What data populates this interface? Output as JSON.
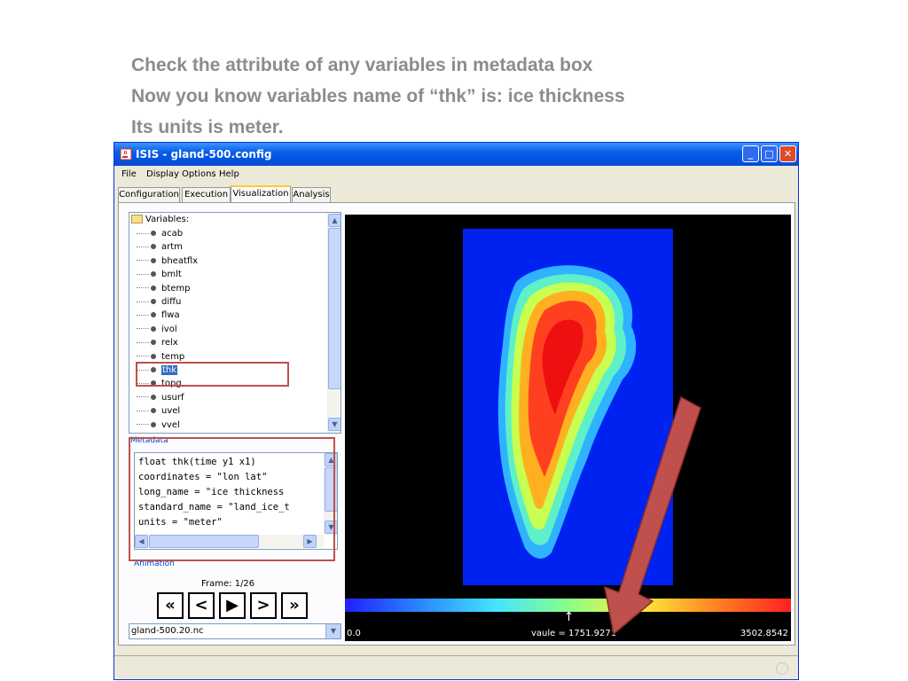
{
  "slide": {
    "lines": [
      "Check the attribute of any variables in metadata box",
      "Now you know variables name of “thk” is: ice thickness",
      "Its units is meter."
    ]
  },
  "window": {
    "title": "ISIS - gland-500.config",
    "min_label": "_",
    "max_label": "□",
    "close_label": "✕"
  },
  "menu": {
    "file": "File",
    "display_options": "Display Options",
    "help": "Help"
  },
  "tabs": [
    "Configuration",
    "Execution",
    "Visualization",
    "Analysis"
  ],
  "active_tab": "Visualization",
  "tree": {
    "root_label": "Variables:",
    "items": [
      "acab",
      "artm",
      "bheatflx",
      "bmlt",
      "btemp",
      "diffu",
      "flwa",
      "ivol",
      "relx",
      "temp",
      "thk",
      "topg",
      "usurf",
      "uvel",
      "vvel"
    ],
    "selected": "thk"
  },
  "metadata": {
    "group_label": "Metadata",
    "lines": [
      "float thk(time y1 x1)",
      "coordinates = \"lon lat\"",
      "long_name = \"ice thickness",
      "standard_name = \"land_ice_t",
      "units = \"meter\""
    ]
  },
  "animation": {
    "group_label": "Animation",
    "frame_label": "Frame:  1/26",
    "buttons": [
      "«",
      "<",
      "▶",
      ">",
      "»"
    ]
  },
  "file_select": {
    "value": "gland-500.20.nc"
  },
  "colorbar": {
    "min": "0.0",
    "max": "3502.8542",
    "value_label": "vaule = 1751.9271",
    "value": 1751.9271,
    "marker": "↑"
  },
  "colors": {
    "callout": "#c0504d",
    "arrow_fill": "#c0504d",
    "titlebar": "#0054e3"
  },
  "icons": {
    "java": "java-cup-icon",
    "folder": "folder-icon",
    "scroll_up": "chevron-up-icon",
    "scroll_down": "chevron-down-icon",
    "scroll_left": "chevron-left-icon",
    "scroll_right": "chevron-right-icon",
    "combo_arrow": "chevron-down-icon"
  }
}
